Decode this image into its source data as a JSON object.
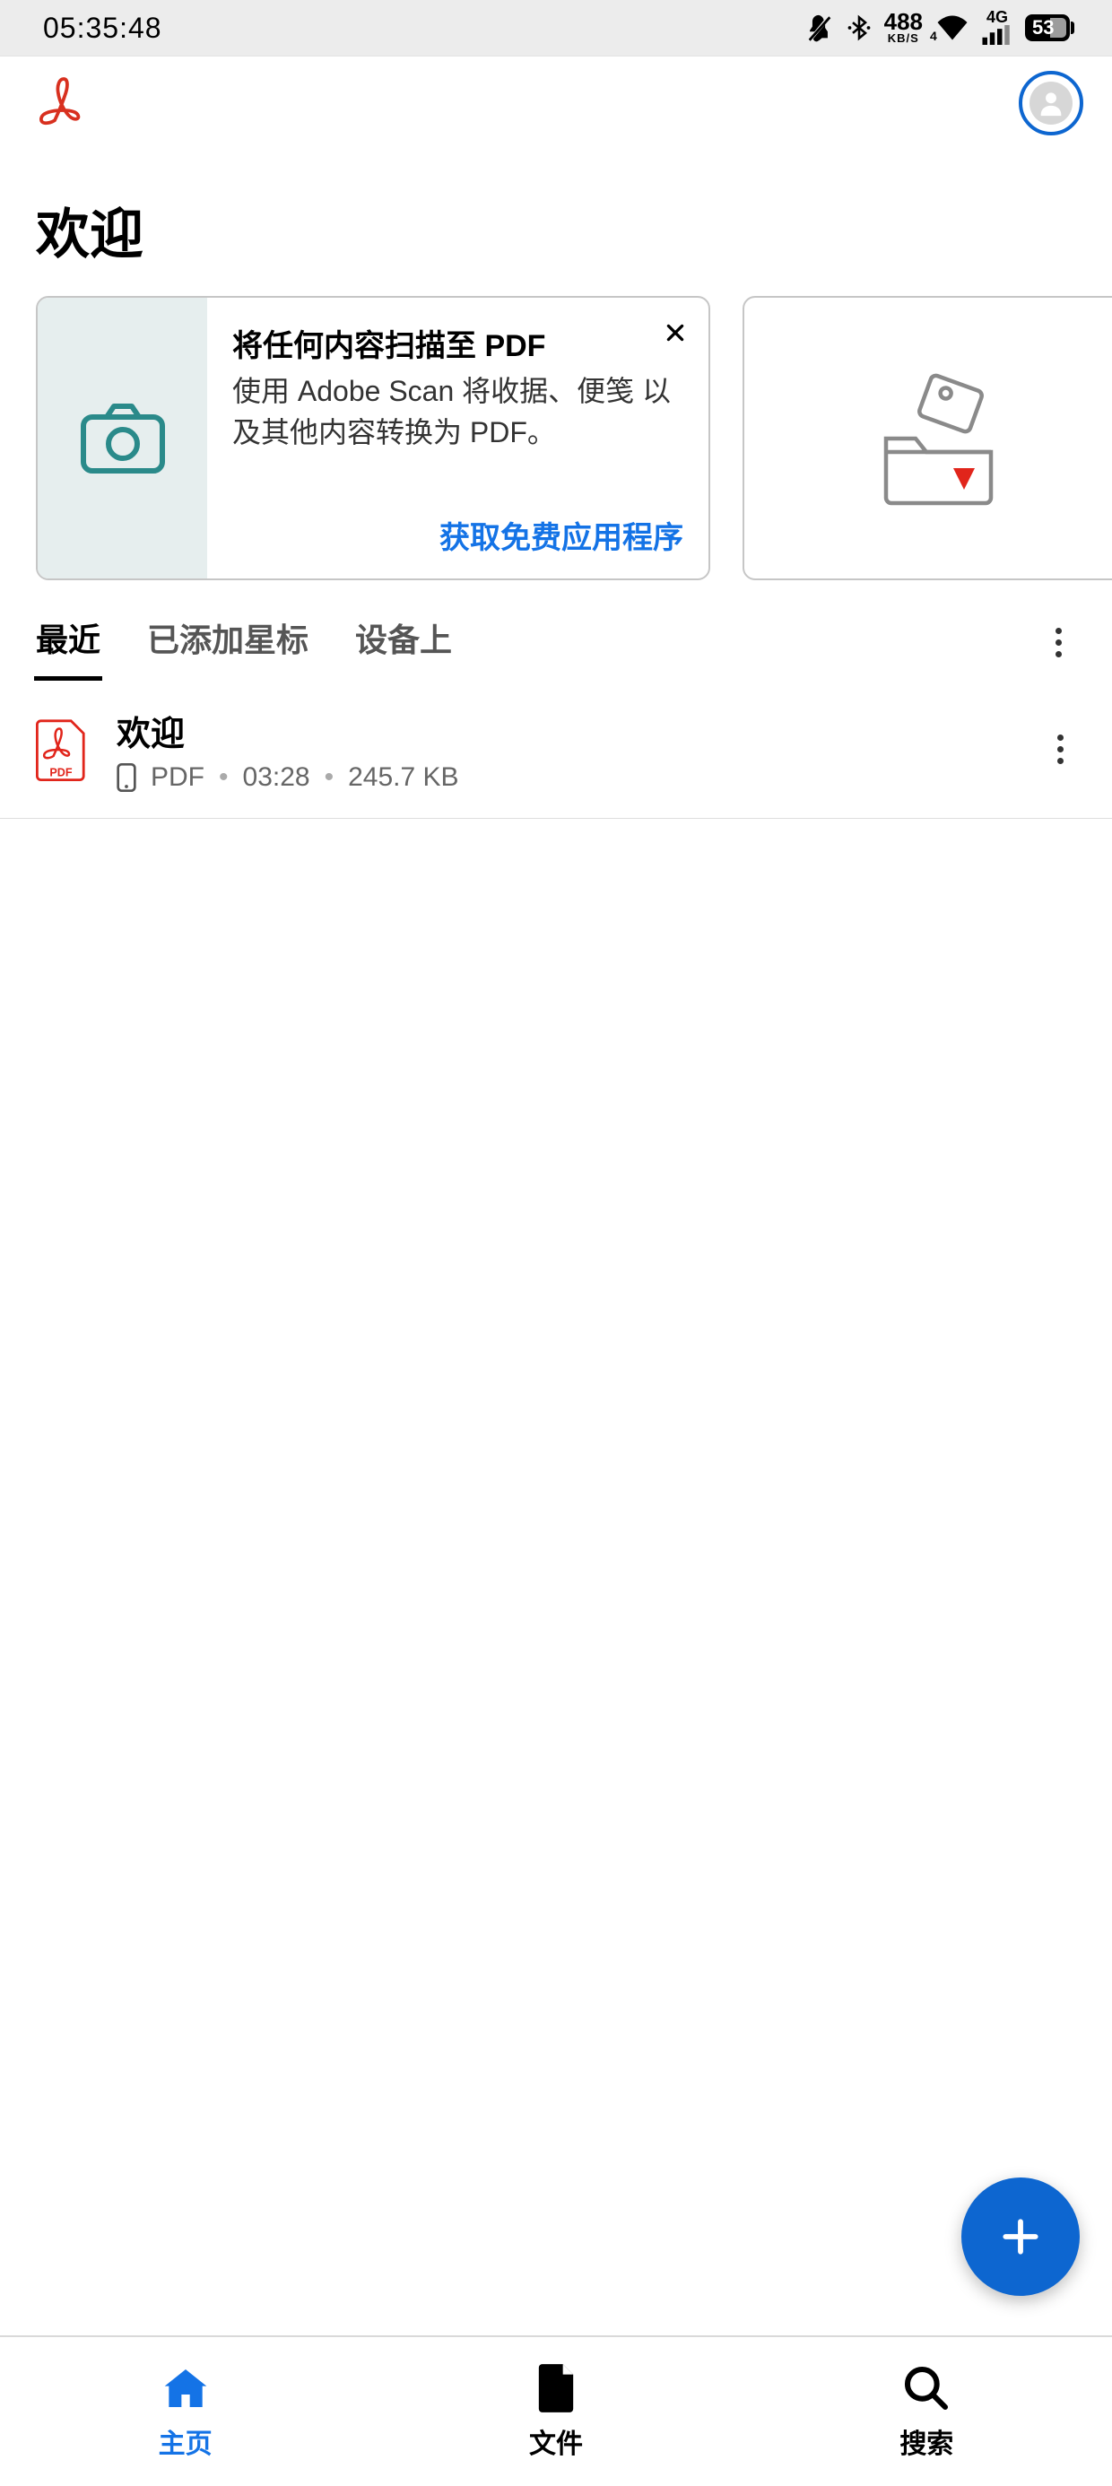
{
  "status": {
    "time": "05:35:48",
    "data_rate_num": "488",
    "data_rate_unit": "KB/S",
    "wifi_sub": "4",
    "net_type": "4G",
    "battery": "53"
  },
  "header": {
    "page_title": "欢迎"
  },
  "promo": {
    "title": "将任何内容扫描至 PDF",
    "desc": "使用 Adobe Scan 将收据、便笺 以及其他内容转换为 PDF。",
    "action": "获取免费应用程序"
  },
  "tabs": {
    "items": [
      "最近",
      "已添加星标",
      "设备上"
    ],
    "active_index": 0
  },
  "files": [
    {
      "name": "欢迎",
      "type": "PDF",
      "time": "03:28",
      "size": "245.7 KB"
    }
  ],
  "nav": {
    "items": [
      "主页",
      "文件",
      "搜索"
    ],
    "active_index": 0
  }
}
